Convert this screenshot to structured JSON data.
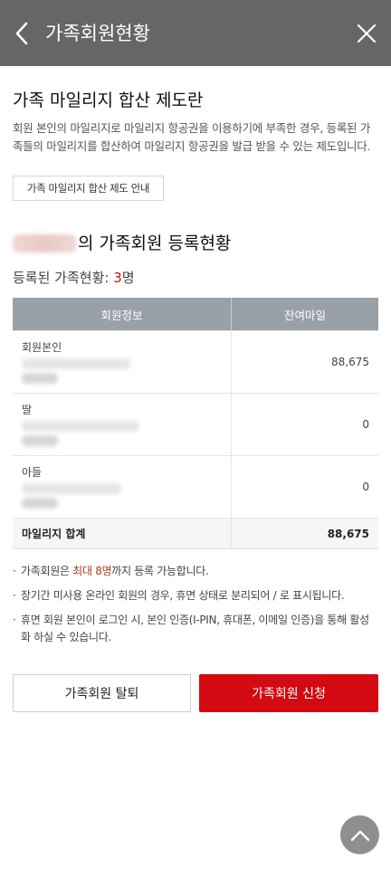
{
  "header": {
    "title": "가족회원현황",
    "back_icon": "chevron-left-icon",
    "close_icon": "close-icon"
  },
  "intro": {
    "title": "가족 마일리지 합산 제도란",
    "description": "회원 본인의 마일리지로 마일리지 항공권을 이용하기에 부족한 경우, 등록된 가족들의 마일리지를 합산하여 마일리지 항공권을 발급 받을 수 있는 제도입니다.",
    "guide_button": "가족 마일리지 합산 제도 안내"
  },
  "status": {
    "title_suffix": "의 가족회원 등록현황",
    "count_label": "등록된 가족현황: ",
    "count_value": "3",
    "count_unit": "명"
  },
  "table": {
    "headers": [
      "회원정보",
      "잔여마일"
    ],
    "rows": [
      {
        "relation": "회원본인",
        "miles": "88,675"
      },
      {
        "relation": "딸",
        "miles": "0"
      },
      {
        "relation": "아들",
        "miles": "0"
      }
    ],
    "total_label": "마일리지 합계",
    "total_value": "88,675"
  },
  "notes": {
    "n1_pre": "가족회원은 ",
    "n1_highlight": "최대 8명",
    "n1_post": "까지 등록 가능합니다.",
    "n2": "장기간 미사용 온라인 회원의 경우, 휴면 상태로 분리되어 / 로 표시됩니다.",
    "n3": "휴면 회원 본인이 로그인 시, 본인 인증(I-PIN, 휴대폰, 이메일 인증)을 통해 활성화 하실 수 있습니다."
  },
  "buttons": {
    "withdraw": "가족회원 탈퇴",
    "apply": "가족회원 신청"
  },
  "colors": {
    "header_bg": "#666666",
    "accent_red": "#d40a12",
    "table_header_bg": "#9aa0a8"
  }
}
